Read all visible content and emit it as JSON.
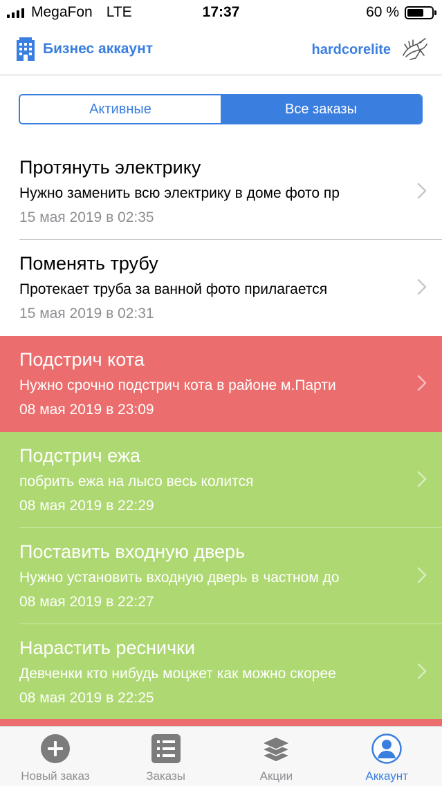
{
  "status_bar": {
    "carrier": "MegaFon",
    "network": "LTE",
    "time": "17:37",
    "battery": "60 %"
  },
  "nav": {
    "title": "Бизнес аккаунт",
    "user": "hardcorelite"
  },
  "segments": {
    "active": "Активные",
    "all": "Все заказы"
  },
  "orders": [
    {
      "title": "Протянуть электрику",
      "description": "Нужно заменить всю электрику в доме фото пр",
      "date": "15 мая 2019 в 02:35",
      "status_color": "white"
    },
    {
      "title": "Поменять трубу",
      "description": "Протекает труба за ванной фото прилагается",
      "date": "15 мая 2019 в 02:31",
      "status_color": "white"
    },
    {
      "title": "Подстрич кота",
      "description": "Нужно срочно подстрич кота в районе м.Парти",
      "date": "08 мая 2019 в 23:09",
      "status_color": "#ec6d6d"
    },
    {
      "title": "Подстрич ежа",
      "description": "побрить ежа на лысо весь колится",
      "date": "08 мая 2019 в 22:29",
      "status_color": "#aed872"
    },
    {
      "title": "Поставить входную дверь",
      "description": "Нужно установить входную дверь в частном до",
      "date": "08 мая 2019 в 22:27",
      "status_color": "#aed872"
    },
    {
      "title": "Нарастить реснички",
      "description": "Девченки кто нибудь моцжет как можно скорее",
      "date": "08 мая 2019 в 22:25",
      "status_color": "#aed872"
    }
  ],
  "tabs": [
    {
      "label": "Новый заказ",
      "icon": "plus-circle-icon"
    },
    {
      "label": "Заказы",
      "icon": "list-icon"
    },
    {
      "label": "Акции",
      "icon": "layers-icon"
    },
    {
      "label": "Аккаунт",
      "icon": "person-icon"
    }
  ],
  "colors": {
    "accent": "#3a7fe0",
    "red": "#ec6d6d",
    "green": "#aed872"
  }
}
